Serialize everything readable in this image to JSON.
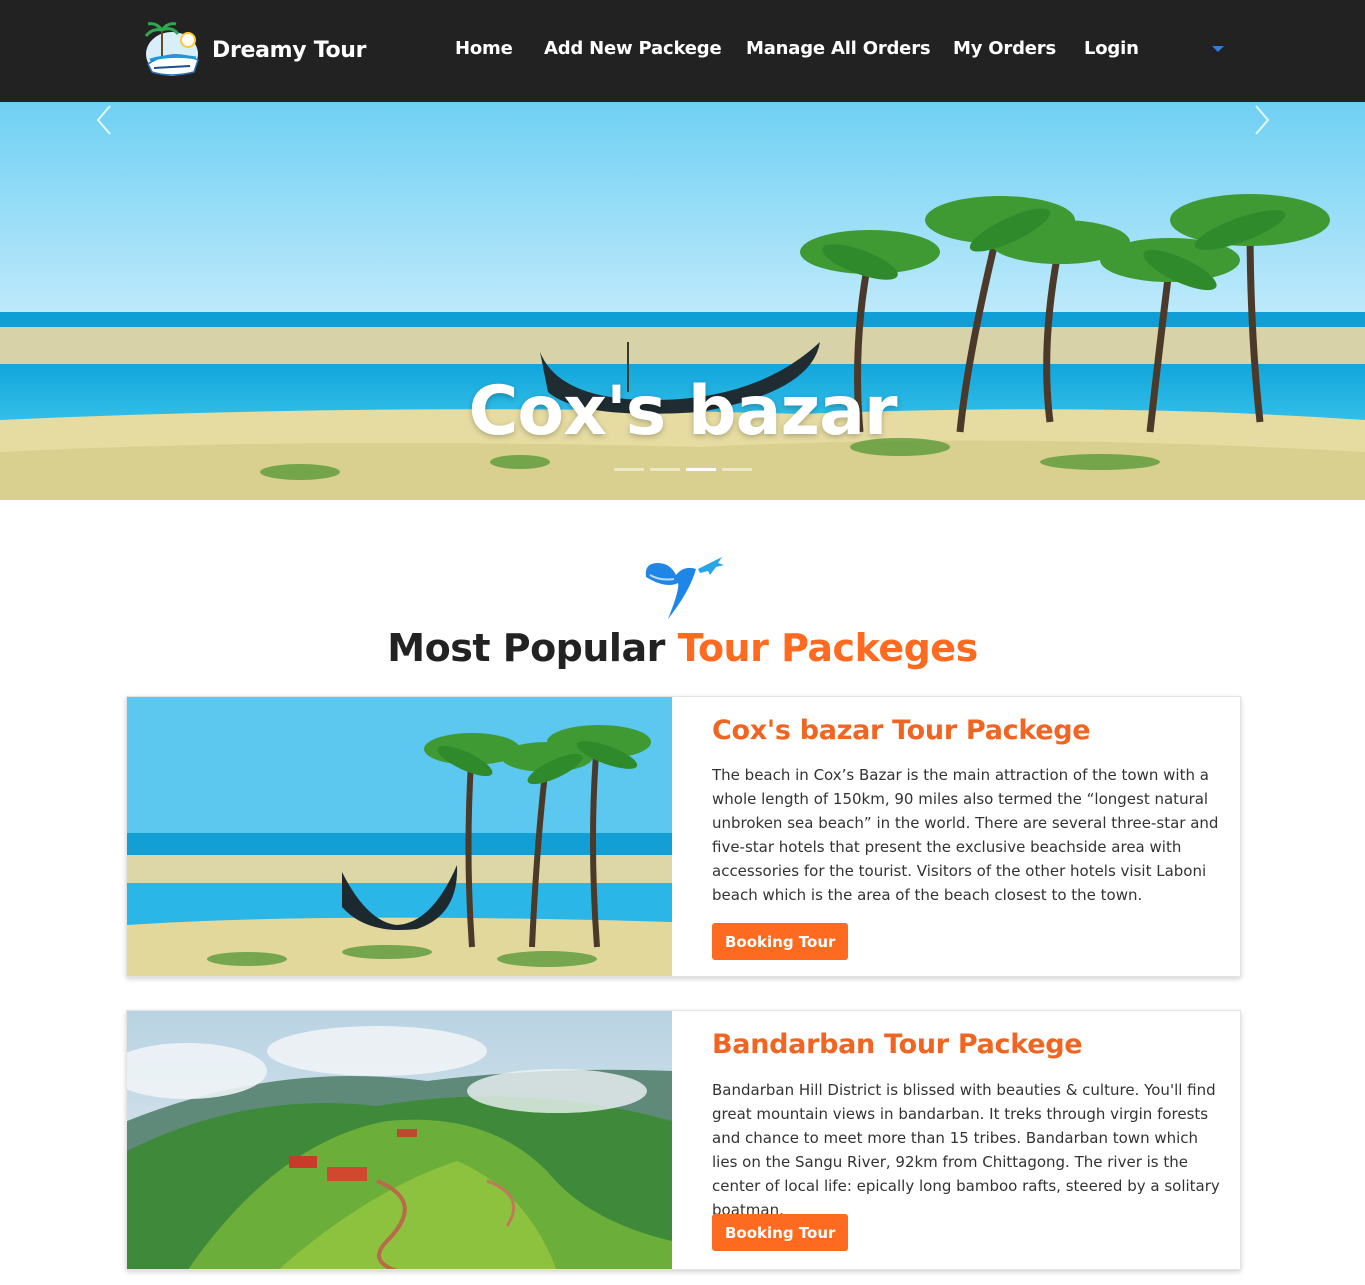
{
  "navbar": {
    "brand": "Dreamy Tour",
    "links": [
      "Home",
      "Add New Packege",
      "Manage All Orders",
      "My Orders",
      "Login"
    ],
    "dropdown_icon": "caret-down-icon",
    "background": "#222222"
  },
  "hero": {
    "title": "Cox's bazar",
    "prev_icon": "chevron-left-icon",
    "next_icon": "chevron-right-icon",
    "indicator_count": 4,
    "active_indicator": 2
  },
  "section": {
    "icon": "heart-airplane-icon",
    "title_part1": "Most Popular",
    "title_part2": "Tour Packeges",
    "accent_color": "#fd6a20"
  },
  "packages": [
    {
      "title": "Cox's bazar Tour Packege",
      "description": "The beach in Cox’s Bazar is the main attraction of the town with a whole length of 150km, 90 miles also termed the “longest natural unbroken sea beach” in the world. There are several three-star and five-star hotels that present the exclusive beachside area with accessories for the tourist. Visitors of the other hotels visit Laboni beach which is the area of the beach closest to the town.",
      "button": "Booking Tour"
    },
    {
      "title": "Bandarban Tour Packege",
      "description": "Bandarban Hill District is blissed with beauties & culture. You'll find great mountain views in bandarban. It treks through virgin forests and chance to meet more than 15 tribes. Bandarban town which lies on the Sangu River, 92km from Chittagong. The river is the center of local life: epically long bamboo rafts, steered by a solitary boatman.",
      "button": "Booking Tour"
    }
  ]
}
